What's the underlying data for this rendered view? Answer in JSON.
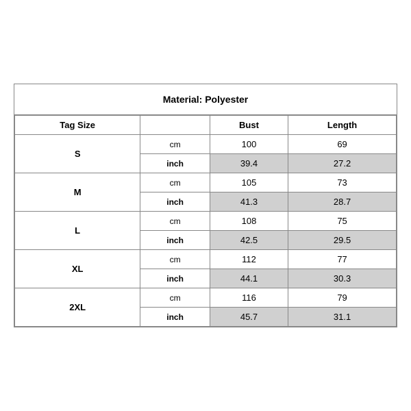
{
  "title": "Material: Polyester",
  "columns": {
    "tag_size": "Tag Size",
    "bust": "Bust",
    "length": "Length"
  },
  "rows": [
    {
      "size": "S",
      "cm": {
        "bust": "100",
        "length": "69"
      },
      "inch": {
        "bust": "39.4",
        "length": "27.2"
      }
    },
    {
      "size": "M",
      "cm": {
        "bust": "105",
        "length": "73"
      },
      "inch": {
        "bust": "41.3",
        "length": "28.7"
      }
    },
    {
      "size": "L",
      "cm": {
        "bust": "108",
        "length": "75"
      },
      "inch": {
        "bust": "42.5",
        "length": "29.5"
      }
    },
    {
      "size": "XL",
      "cm": {
        "bust": "112",
        "length": "77"
      },
      "inch": {
        "bust": "44.1",
        "length": "30.3"
      }
    },
    {
      "size": "2XL",
      "cm": {
        "bust": "116",
        "length": "79"
      },
      "inch": {
        "bust": "45.7",
        "length": "31.1"
      }
    }
  ]
}
